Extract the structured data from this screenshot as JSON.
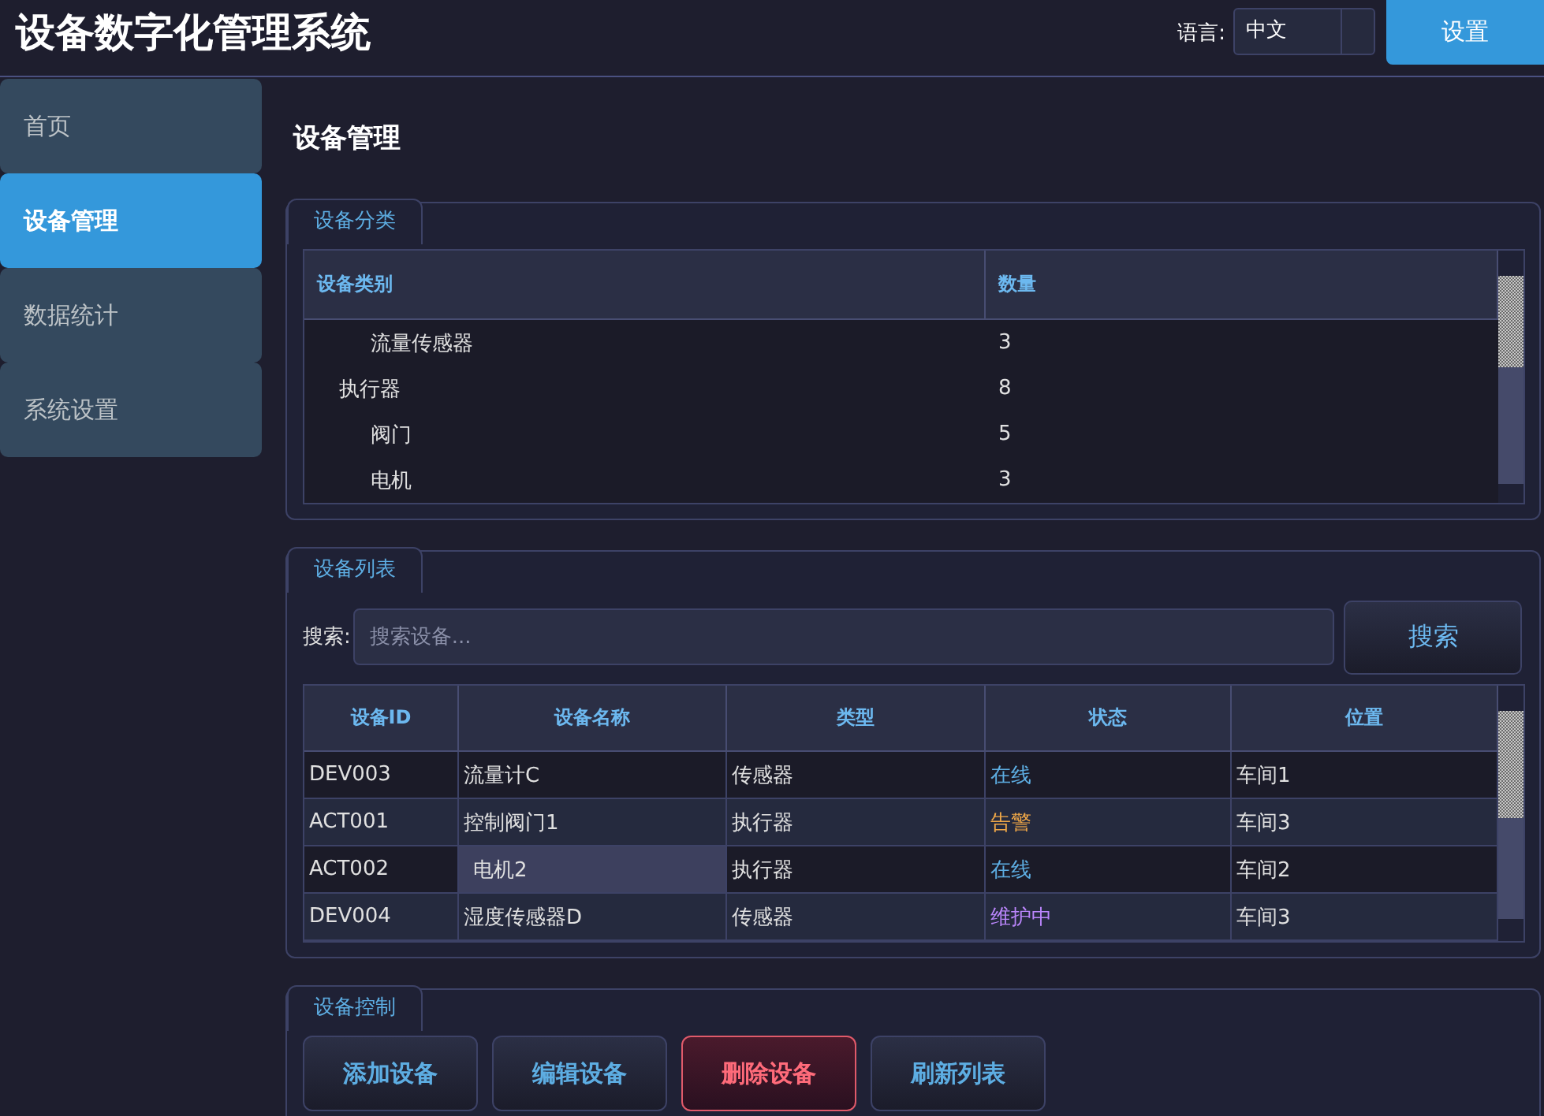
{
  "header": {
    "title": "设备数字化管理系统",
    "language_label": "语言:",
    "language_select": {
      "value": "中文"
    },
    "settings_button": "设置"
  },
  "sidebar": {
    "items": [
      {
        "label": "首页",
        "selected": false
      },
      {
        "label": "设备管理",
        "selected": true
      },
      {
        "label": "数据统计",
        "selected": false
      },
      {
        "label": "系统设置",
        "selected": false
      }
    ]
  },
  "page_title": "设备管理",
  "category_group": {
    "tab": "设备分类",
    "table": {
      "columns": [
        "设备类别",
        "数量"
      ],
      "rows": [
        {
          "children": [
            {
              "category": "流量传感器",
              "count": "3"
            }
          ]
        },
        {
          "category": "执行器",
          "count": "8",
          "children": [
            {
              "category": "阀门",
              "count": "5"
            },
            {
              "category": "电机",
              "count": "3"
            }
          ]
        }
      ]
    }
  },
  "device_group": {
    "tab": "设备列表",
    "search_label": "搜索:",
    "search": {
      "placeholder": "搜索设备..."
    },
    "search_button": "搜索",
    "table": {
      "columns": [
        "设备ID",
        "设备名称",
        "类型",
        "状态",
        "位置"
      ],
      "rows": [
        {
          "id": "DEV003",
          "name": "流量计C",
          "type": "传感器",
          "status": {
            "label": "在线",
            "color": "#5dade2"
          },
          "location": "车间1",
          "selected": false
        },
        {
          "id": "ACT001",
          "name": "控制阀门1",
          "type": "执行器",
          "status": {
            "label": "告警",
            "color": "#f0a848"
          },
          "location": "车间3",
          "selected": false
        },
        {
          "id": "ACT002",
          "name": "电机2",
          "type": "执行器",
          "status": {
            "label": "在线",
            "color": "#5dade2"
          },
          "location": "车间2",
          "selected": true
        },
        {
          "id": "DEV004",
          "name": "湿度传感器D",
          "type": "传感器",
          "status": {
            "label": "维护中",
            "color": "#bb86fc"
          },
          "location": "车间3",
          "selected": false
        }
      ]
    }
  },
  "control_group": {
    "tab": "设备控制",
    "buttons": [
      {
        "label": "添加设备",
        "kind": "normal"
      },
      {
        "label": "编辑设备",
        "kind": "normal"
      },
      {
        "label": "删除设备",
        "kind": "danger"
      },
      {
        "label": "刷新列表",
        "kind": "normal"
      }
    ]
  }
}
